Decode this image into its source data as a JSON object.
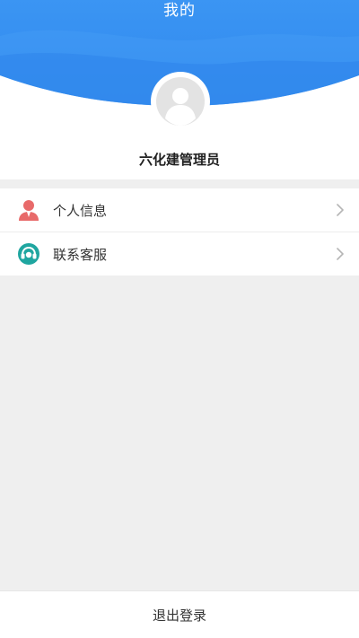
{
  "header": {
    "title": "我的"
  },
  "profile": {
    "name": "六化建管理员",
    "avatar_icon": "default-user-avatar-icon"
  },
  "menu": {
    "items": [
      {
        "label": "个人信息",
        "icon": "person-icon",
        "color": "#e86a6a"
      },
      {
        "label": "联系客服",
        "icon": "headset-icon",
        "color": "#1fa6a0"
      }
    ]
  },
  "footer": {
    "logout_label": "退出登录"
  },
  "colors": {
    "accent_blue": "#2e8ef0",
    "background": "#efefef"
  }
}
